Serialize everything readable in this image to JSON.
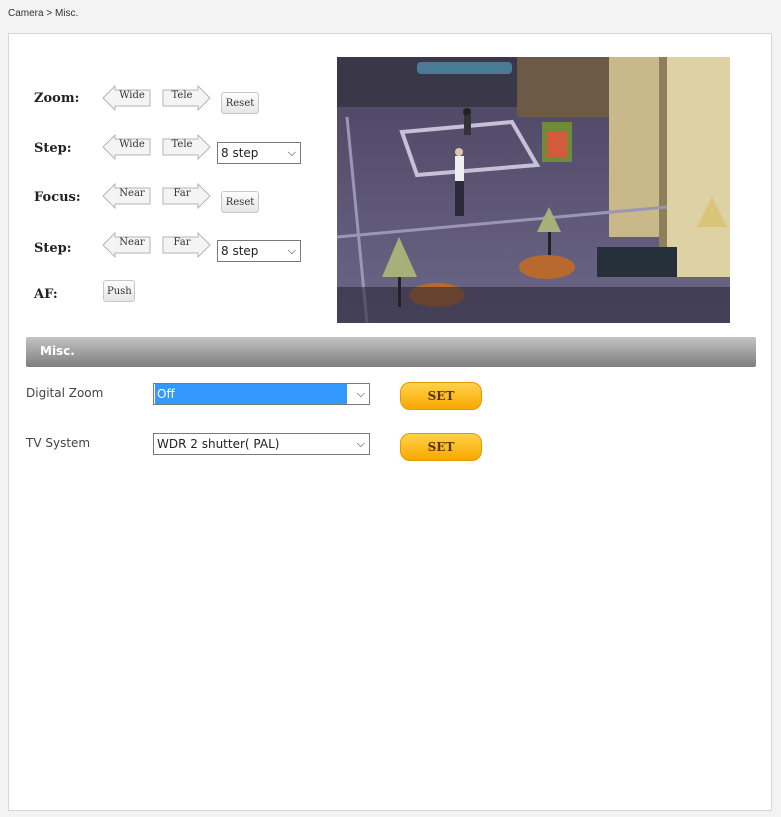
{
  "breadcrumb": "Camera > Misc.",
  "controls": {
    "zoom": {
      "label": "Zoom:",
      "left": "Wide",
      "right": "Tele",
      "reset": "Reset"
    },
    "zoom_step": {
      "label": "Step:",
      "left": "Wide",
      "right": "Tele",
      "value": "8 step"
    },
    "focus": {
      "label": "Focus:",
      "left": "Near",
      "right": "Far",
      "reset": "Reset"
    },
    "focus_step": {
      "label": "Step:",
      "left": "Near",
      "right": "Far",
      "value": "8 step"
    },
    "af": {
      "label": "AF:",
      "button": "Push"
    }
  },
  "section": {
    "title": "Misc."
  },
  "settings": [
    {
      "label": "Digital Zoom",
      "value": "Off",
      "button": "SET"
    },
    {
      "label": "TV System",
      "value": "WDR 2 shutter( PAL)",
      "button": "SET"
    }
  ],
  "colors": {
    "set_button": "#f8b400",
    "section_bar": "#8a8a8a",
    "selected_option": "#3399ff"
  }
}
